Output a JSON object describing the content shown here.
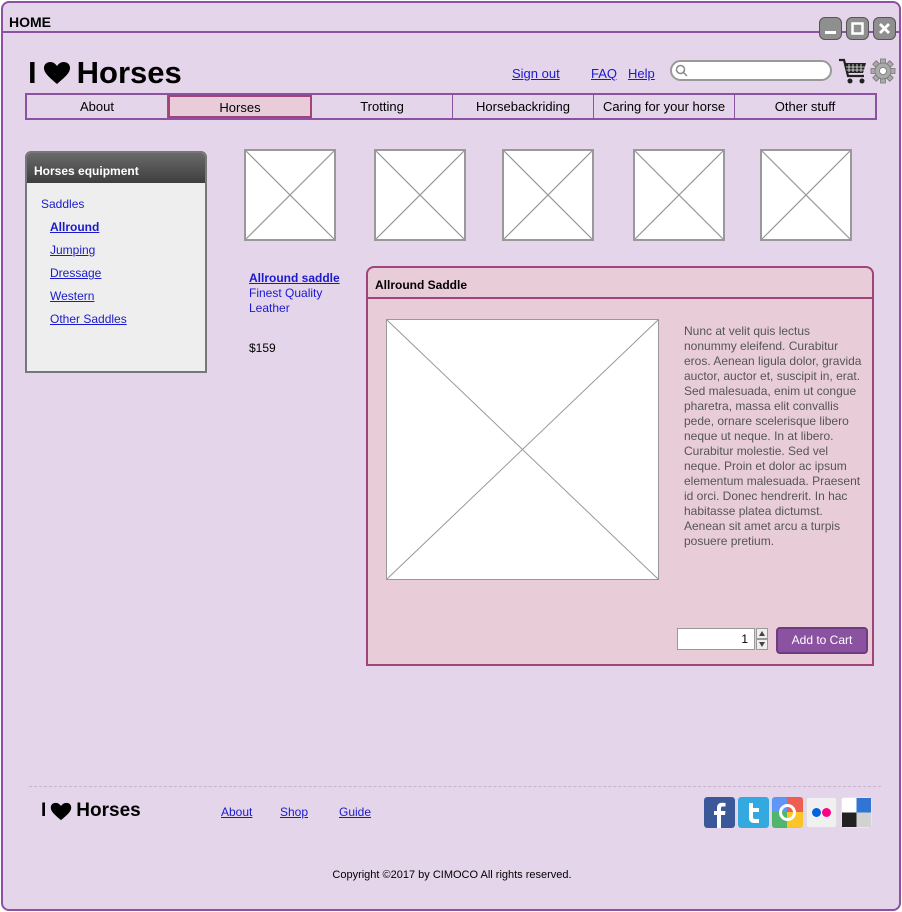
{
  "window": {
    "title": "HOME"
  },
  "logo": {
    "text_before": "I",
    "text_after": "Horses"
  },
  "header": {
    "links": [
      "Sign out",
      "FAQ",
      "Help"
    ],
    "search_placeholder": ""
  },
  "nav": {
    "items": [
      "About",
      "Horses",
      "Trotting",
      "Horsebackriding",
      "Caring for your horse",
      "Other stuff"
    ],
    "active": "Horses"
  },
  "sidebar": {
    "title": "Horses equipment",
    "category": "Saddles",
    "items": [
      "Allround",
      "Jumping",
      "Dressage",
      "Western",
      "Other Saddles"
    ],
    "selected": "Allround"
  },
  "product": {
    "name": "Allround saddle",
    "line1": "Finest Quality",
    "line2": "Leather",
    "price": "$159"
  },
  "detail": {
    "title": "Allround Saddle",
    "description": "Nunc at velit quis lectus nonummy eleifend. Curabitur eros. Aenean ligula dolor, gravida auctor, auctor et, suscipit in, erat. Sed malesuada, enim ut congue pharetra, massa elit convallis pede, ornare scelerisque libero neque ut neque. In at libero. Curabitur molestie. Sed vel neque. Proin et dolor ac ipsum elementum malesuada. Praesent id orci. Donec hendrerit. In hac habitasse platea dictumst. Aenean sit amet arcu a turpis posuere pretium.",
    "quantity": "1",
    "add_label": "Add to Cart"
  },
  "footer": {
    "logo_before": "I",
    "logo_after": "Horses",
    "links": [
      "About",
      "Shop",
      "Guide"
    ],
    "social": [
      "facebook-icon",
      "twitter-icon",
      "google-icon",
      "flickr-icon",
      "delicious-icon"
    ],
    "copyright": "Copyright ©2017 by CIMOCO All rights reserved."
  },
  "colors": {
    "frame": "#8a52a0",
    "background": "#e5d5ea",
    "accent": "#a0447b",
    "link": "#1a1acc"
  }
}
